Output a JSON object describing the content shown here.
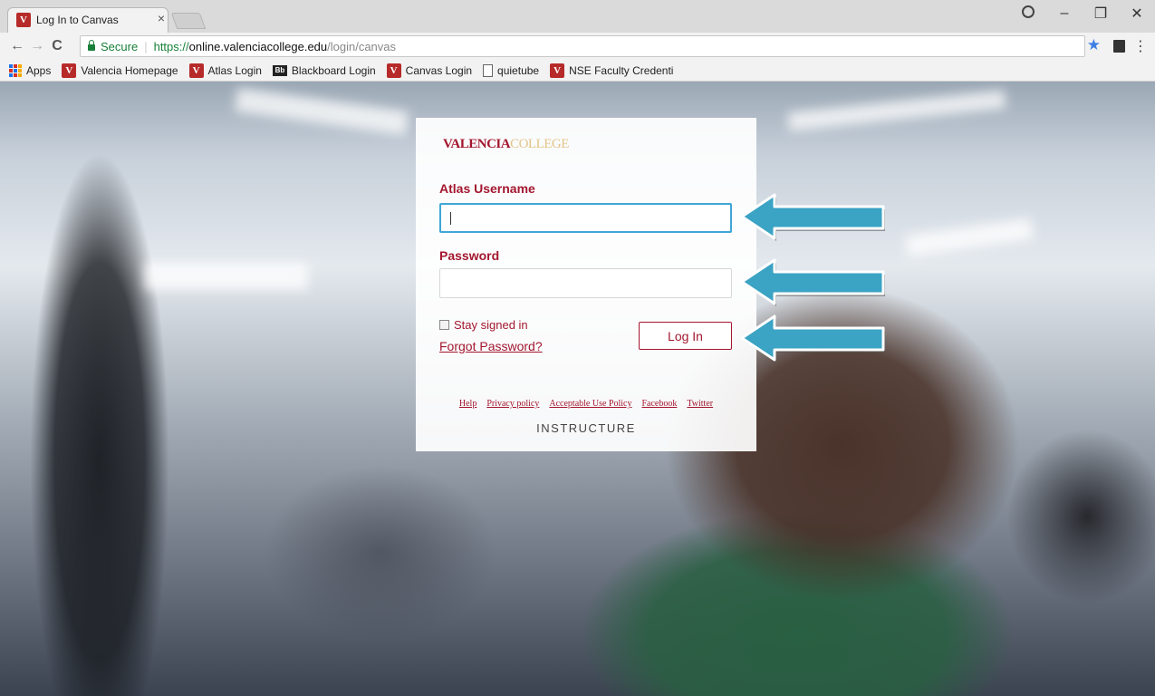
{
  "browser": {
    "tab_title": "Log In to Canvas",
    "tab_close": "×",
    "window_controls": {
      "minimize": "–",
      "restore": "❐",
      "close": "✕"
    },
    "nav": {
      "back": "←",
      "forward": "→",
      "reload": "C"
    },
    "security_label": "Secure",
    "url_scheme": "https://",
    "url_host": "online.valenciacollege.edu",
    "url_path": "/login/canvas",
    "bookmark_star": "★",
    "menu": "⋮",
    "bookmarks": [
      {
        "label": "Apps",
        "icon": "apps-grid-icon"
      },
      {
        "label": "Valencia Homepage",
        "icon": "valencia-v-icon"
      },
      {
        "label": "Atlas Login",
        "icon": "valencia-v-icon"
      },
      {
        "label": "Blackboard Login",
        "icon": "blackboard-icon",
        "badge": "Bb"
      },
      {
        "label": "Canvas Login",
        "icon": "valencia-v-icon"
      },
      {
        "label": "quietube",
        "icon": "document-icon"
      },
      {
        "label": "NSE Faculty Credenti",
        "icon": "valencia-v-icon"
      }
    ],
    "favicon_letter": "V"
  },
  "login": {
    "logo_primary": "VALENCIA",
    "logo_secondary": "COLLEGE",
    "username_label": "Atlas Username",
    "username_value": "",
    "password_label": "Password",
    "password_value": "",
    "stay_signed_in": "Stay signed in",
    "forgot_password": "Forgot Password?",
    "login_button": "Log In",
    "footer_links": [
      "Help",
      "Privacy policy",
      "Acceptable Use Policy",
      "Facebook",
      "Twitter"
    ],
    "brand": "INSTRUCTURE"
  },
  "colors": {
    "brand_red": "#a3172f",
    "brand_gold": "#e2c488",
    "arrow_fill": "#3ba3c4",
    "focus_border": "#3fa6d6"
  }
}
